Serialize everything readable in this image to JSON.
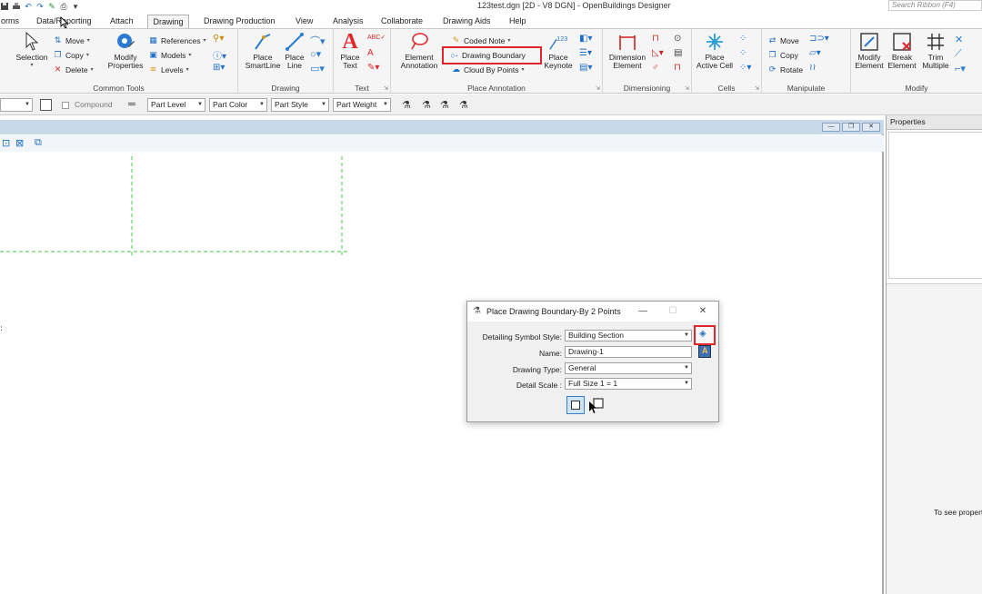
{
  "titlebar": {
    "title": "123test.dgn [2D - V8 DGN] - OpenBuildings Designer",
    "search_placeholder": "Search Ribbon (F4)",
    "qat_icons": [
      "save-icon",
      "print-icon",
      "undo-icon",
      "redo-icon",
      "pin-icon",
      "quick-access-customize-icon"
    ]
  },
  "tabs": [
    {
      "label": "orms"
    },
    {
      "label": "Data/Reporting"
    },
    {
      "label": "Attach"
    },
    {
      "label": "Drawing",
      "active": true
    },
    {
      "label": "Drawing Production"
    },
    {
      "label": "View"
    },
    {
      "label": "Analysis"
    },
    {
      "label": "Collaborate"
    },
    {
      "label": "Drawing Aids"
    },
    {
      "label": "Help"
    }
  ],
  "ribbon": {
    "common_tools": {
      "label": "Common Tools",
      "selection": "Selection",
      "move": "Move",
      "copy": "Copy",
      "delete": "Delete",
      "modify_properties": "Modify Properties",
      "references": "References",
      "models": "Models",
      "levels": "Levels"
    },
    "drawing": {
      "label": "Drawing",
      "place_smartline": "Place SmartLine",
      "place_line": "Place Line"
    },
    "text": {
      "label": "Text",
      "place_text": "Place Text"
    },
    "place_annotation": {
      "label": "Place Annotation",
      "element_annotation": "Element Annotation",
      "coded_note": "Coded Note",
      "drawing_boundary": "Drawing Boundary",
      "cloud_by_points": "Cloud By Points",
      "place_keynote": "Place Keynote",
      "keynote_badge": "123"
    },
    "dimensioning": {
      "label": "Dimensioning",
      "dimension_element": "Dimension Element"
    },
    "cells": {
      "label": "Cells",
      "place_active_cell": "Place Active Cell"
    },
    "manipulate": {
      "label": "Manipulate",
      "move": "Move",
      "copy": "Copy",
      "rotate": "Rotate"
    },
    "modify": {
      "label": "Modify",
      "modify_element": "Modify Element",
      "break_element": "Break Element",
      "trim_multiple": "Trim Multiple"
    }
  },
  "attributes_bar": {
    "compound": "Compound",
    "part_level": "Part Level",
    "part_color": "Part Color",
    "part_style": "Part Style",
    "part_weight": "Part Weight"
  },
  "properties": {
    "title": "Properties",
    "hint": "To see propert"
  },
  "dialog": {
    "title": "Place Drawing Boundary-By 2 Points",
    "symbol_style_label": "Detailing Symbol Style:",
    "symbol_style_value": "Building Section",
    "name_label": "Name:",
    "name_value": "Drawing-1",
    "drawing_type_label": "Drawing Type:",
    "drawing_type_value": "General",
    "detail_scale_label": "Detail Scale :",
    "detail_scale_value": "Full Size 1 = 1",
    "minimize": "—",
    "maximize": "☐",
    "close": "✕"
  },
  "colors": {
    "highlight": "#e0262b",
    "boundary_dash": "#66d466",
    "view_title": "#c6d8ea",
    "accent_blue": "#1f6fc5"
  }
}
